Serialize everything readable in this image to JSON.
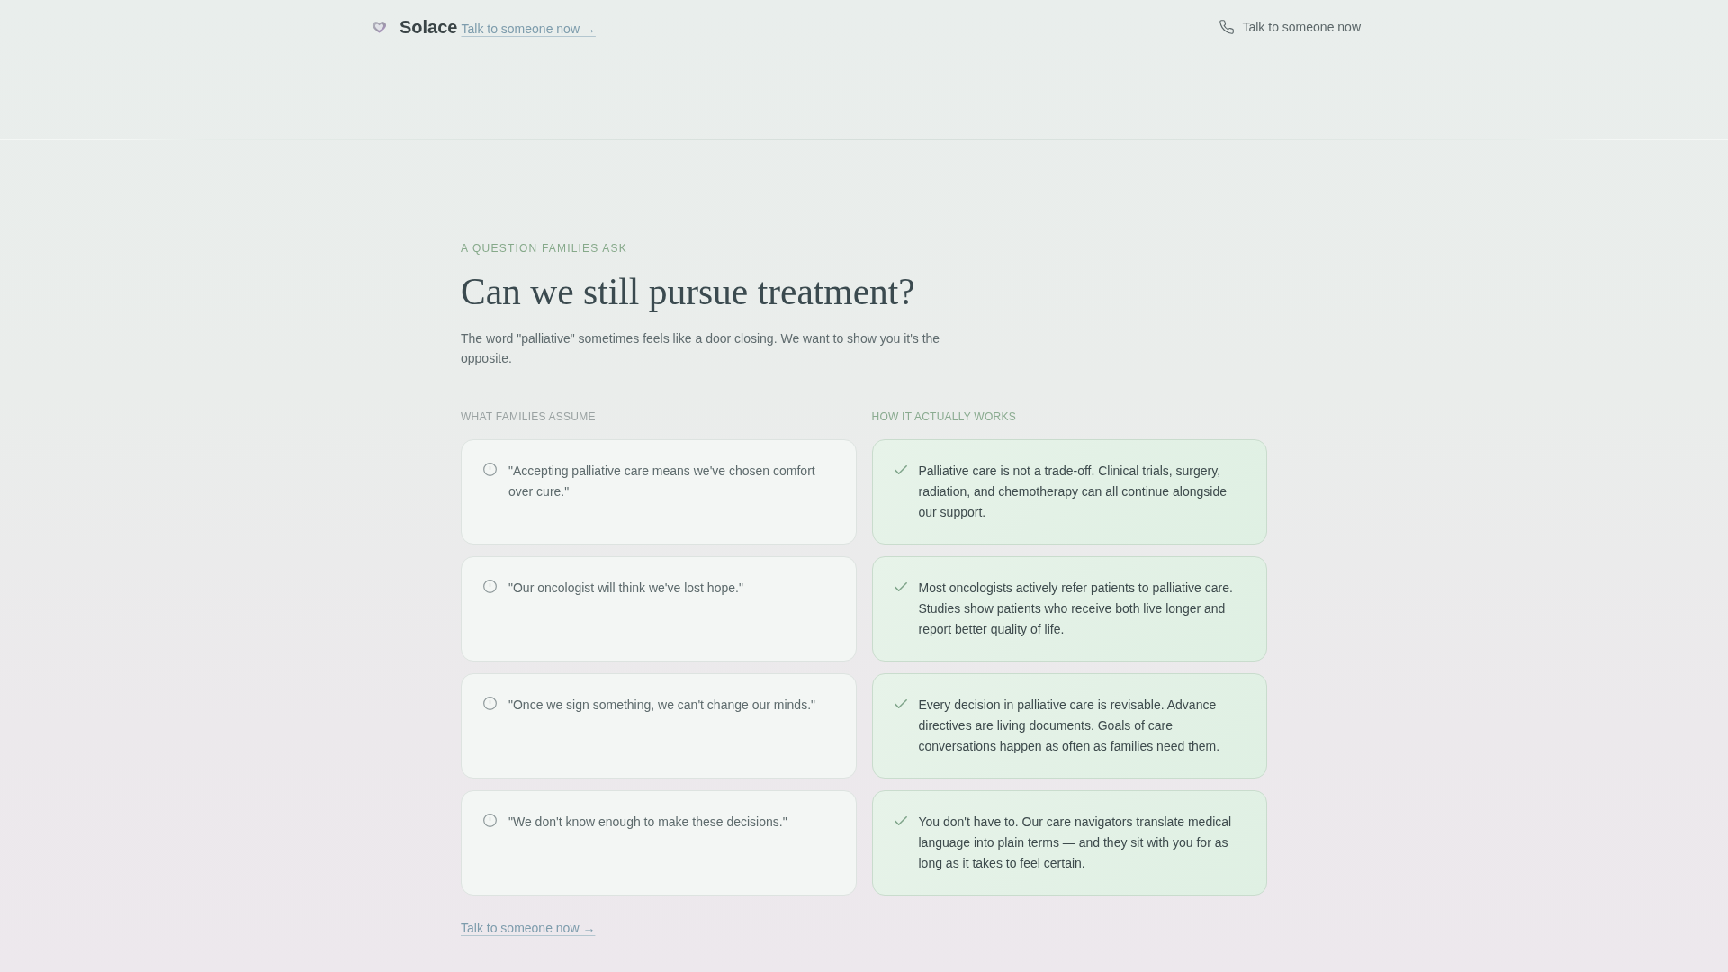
{
  "header": {
    "brand": "Solace",
    "brand_link": "Talk to someone now →",
    "contact": "Talk to someone now"
  },
  "intro": {
    "eyebrow": "A QUESTION FAMILIES ASK",
    "title": "Can we still pursue treatment?",
    "description": "The word \"palliative\" sometimes feels like a door closing. We want to show you it's the opposite."
  },
  "comparison": {
    "assumptions_label": "WHAT FAMILIES ASSUME",
    "facts_label": "HOW IT ACTUALLY WORKS",
    "pairs": [
      {
        "assumption": "\"Accepting palliative care means we've chosen comfort over cure.\"",
        "fact": "Palliative care is not a trade-off. Clinical trials, surgery, radiation, and chemotherapy can all continue alongside our support."
      },
      {
        "assumption": "\"Our oncologist will think we've lost hope.\"",
        "fact": "Most oncologists actively refer patients to palliative care. Studies show patients who receive both live longer and report better quality of life."
      },
      {
        "assumption": "\"Once we sign something, we can't change our minds.\"",
        "fact": "Every decision in palliative care is revisable. Advance directives are living documents. Goals of care conversations happen as often as families need them."
      },
      {
        "assumption": "\"We don't know enough to make these decisions.\"",
        "fact": "You don't have to. Our care navigators translate medical language into plain terms — and they sit with you for as long as it takes to feel certain."
      }
    ]
  },
  "footer_link": "Talk to someone now →"
}
